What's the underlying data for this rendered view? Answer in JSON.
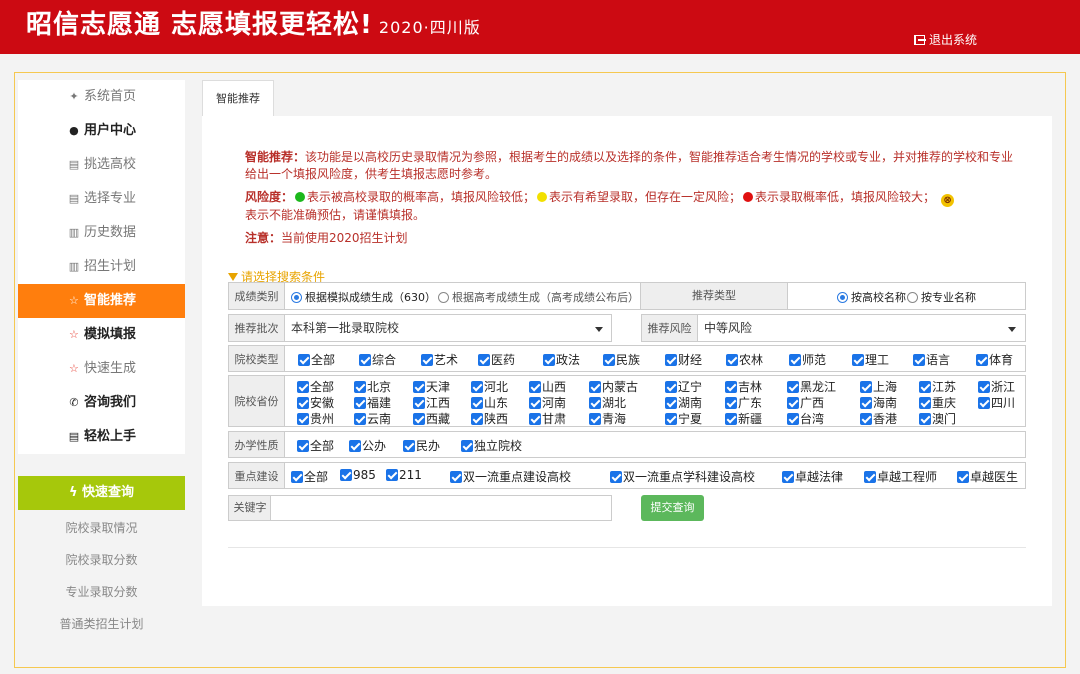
{
  "header": {
    "title": "昭信志愿通 志愿填报更轻松!",
    "edition": "2020·四川版",
    "logout": "退出系统"
  },
  "sidebar": {
    "items": [
      {
        "icon": "home-icon",
        "glyph": "✦",
        "label": "系统首页"
      },
      {
        "icon": "user-icon",
        "glyph": "●",
        "label": "用户中心"
      },
      {
        "icon": "book-icon",
        "glyph": "▤",
        "label": "挑选高校"
      },
      {
        "icon": "book-icon",
        "glyph": "▤",
        "label": "选择专业"
      },
      {
        "icon": "chart-icon",
        "glyph": "▥",
        "label": "历史数据"
      },
      {
        "icon": "chart-icon",
        "glyph": "▥",
        "label": "招生计划"
      },
      {
        "icon": "star-icon",
        "glyph": "☆",
        "label": "智能推荐"
      },
      {
        "icon": "star-icon",
        "glyph": "☆",
        "label": "模拟填报"
      },
      {
        "icon": "star-icon",
        "glyph": "☆",
        "label": "快速生成"
      },
      {
        "icon": "phone-icon",
        "glyph": "✆",
        "label": "咨询我们"
      },
      {
        "icon": "book-icon",
        "glyph": "▤",
        "label": "轻松上手"
      }
    ],
    "quick_query": "快速查询",
    "quick_glyph": "ϟ",
    "sub_links": [
      "院校录取情况",
      "院校录取分数",
      "专业录取分数",
      "普通类招生计划"
    ]
  },
  "tab": "智能推荐",
  "info": {
    "rec_title": "智能推荐：",
    "rec_text": "该功能是以高校历史录取情况为参照，根据考生的成绩以及选择的条件，智能推荐适合考生情况的学校或专业，并对推荐的学校和专业给出一个填报风险度，供考生填报志愿时参考。",
    "risk_title": "风险度：",
    "risk_green": "表示被高校录取的概率高，填报风险较低；",
    "risk_yellow": "表示有希望录取，但存在一定风险；",
    "risk_red": "表示录取概率低，填报风险较大；",
    "risk_x_glyph": "⊗",
    "risk_x": "表示不能准确预估，请谨慎填报。",
    "note_title": "注意：",
    "note_text": "当前使用2020招生计划"
  },
  "filter": {
    "title": "请选择搜索条件",
    "score_type": {
      "label": "成绩类别",
      "opt1": "根据模拟成绩生成（630）",
      "opt2": "根据高考成绩生成（高考成绩公布后）"
    },
    "rec_type": {
      "label": "推荐类型",
      "opt1": "按高校名称",
      "opt2": "按专业名称"
    },
    "batch": {
      "label": "推荐批次",
      "value": "本科第一批录取院校"
    },
    "risk": {
      "label": "推荐风险",
      "value": "中等风险"
    },
    "school_type": {
      "label": "院校类型",
      "items": [
        "全部",
        "综合",
        "艺术",
        "医药",
        "政法",
        "民族",
        "财经",
        "农林",
        "师范",
        "理工",
        "语言",
        "体育"
      ]
    },
    "province": {
      "label": "院校省份",
      "items": [
        "全部",
        "北京",
        "天津",
        "河北",
        "山西",
        "内蒙古",
        "辽宁",
        "吉林",
        "黑龙江",
        "上海",
        "江苏",
        "浙江",
        "安徽",
        "福建",
        "江西",
        "山东",
        "河南",
        "湖北",
        "湖南",
        "广东",
        "广西",
        "海南",
        "重庆",
        "四川",
        "贵州",
        "云南",
        "西藏",
        "陕西",
        "甘肃",
        "青海",
        "宁夏",
        "新疆",
        "台湾",
        "香港",
        "澳门"
      ]
    },
    "nature": {
      "label": "办学性质",
      "items": [
        "全部",
        "公办",
        "民办",
        "独立院校"
      ]
    },
    "key": {
      "label": "重点建设",
      "items": [
        "全部",
        "985",
        "211",
        "双一流重点建设高校",
        "双一流重点学科建设高校",
        "卓越法律",
        "卓越工程师",
        "卓越医生"
      ]
    },
    "keyword": {
      "label": "关键字",
      "value": ""
    },
    "submit": "提交查询"
  }
}
